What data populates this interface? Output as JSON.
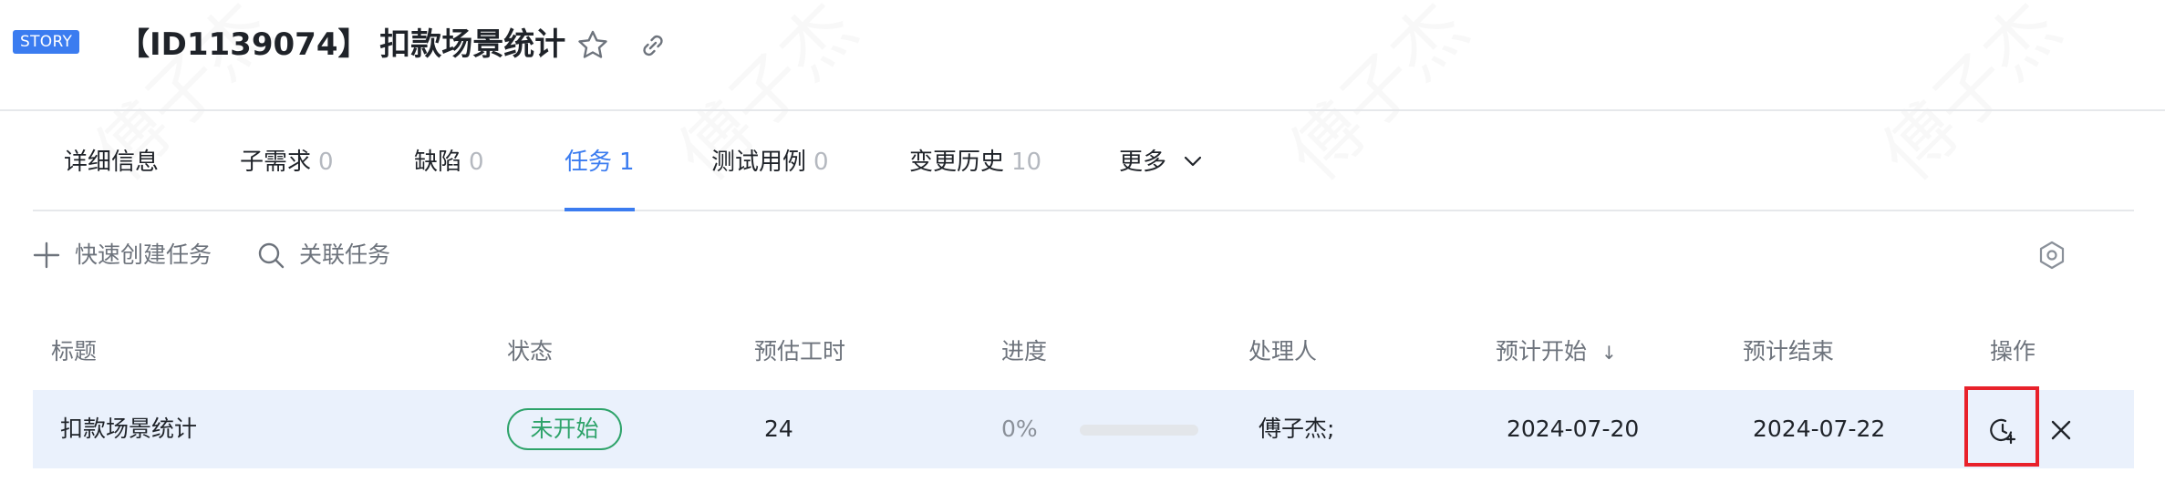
{
  "header": {
    "type_badge": "STORY",
    "title": "【ID1139074】 扣款场景统计",
    "star_icon": "star-icon",
    "link_icon": "link-icon"
  },
  "tabs": [
    {
      "label": "详细信息",
      "count": ""
    },
    {
      "label": "子需求",
      "count": "0"
    },
    {
      "label": "缺陷",
      "count": "0"
    },
    {
      "label": "任务",
      "count": "1",
      "active": true
    },
    {
      "label": "测试用例",
      "count": "0"
    },
    {
      "label": "变更历史",
      "count": "10"
    },
    {
      "label": "更多",
      "count": ""
    }
  ],
  "toolbar": {
    "quick_create": "快速创建任务",
    "link_task": "关联任务",
    "settings_icon": "settings-icon"
  },
  "table": {
    "columns": [
      "标题",
      "状态",
      "预估工时",
      "进度",
      "处理人",
      "预计开始",
      "预计结束",
      "操作"
    ],
    "sort_indicator": "↓",
    "rows": [
      {
        "title": "扣款场景统计",
        "status": "未开始",
        "estimate": "24",
        "progress_text": "0%",
        "progress": 0,
        "assignee": "傅子杰;",
        "start": "2024-07-20",
        "end": "2024-07-22"
      }
    ]
  },
  "watermark": "傅子杰",
  "colors": {
    "accent": "#3b7cf0",
    "status_green": "#2ea36a",
    "row_selected": "#eaf1fc",
    "highlight": "#e8212b"
  }
}
